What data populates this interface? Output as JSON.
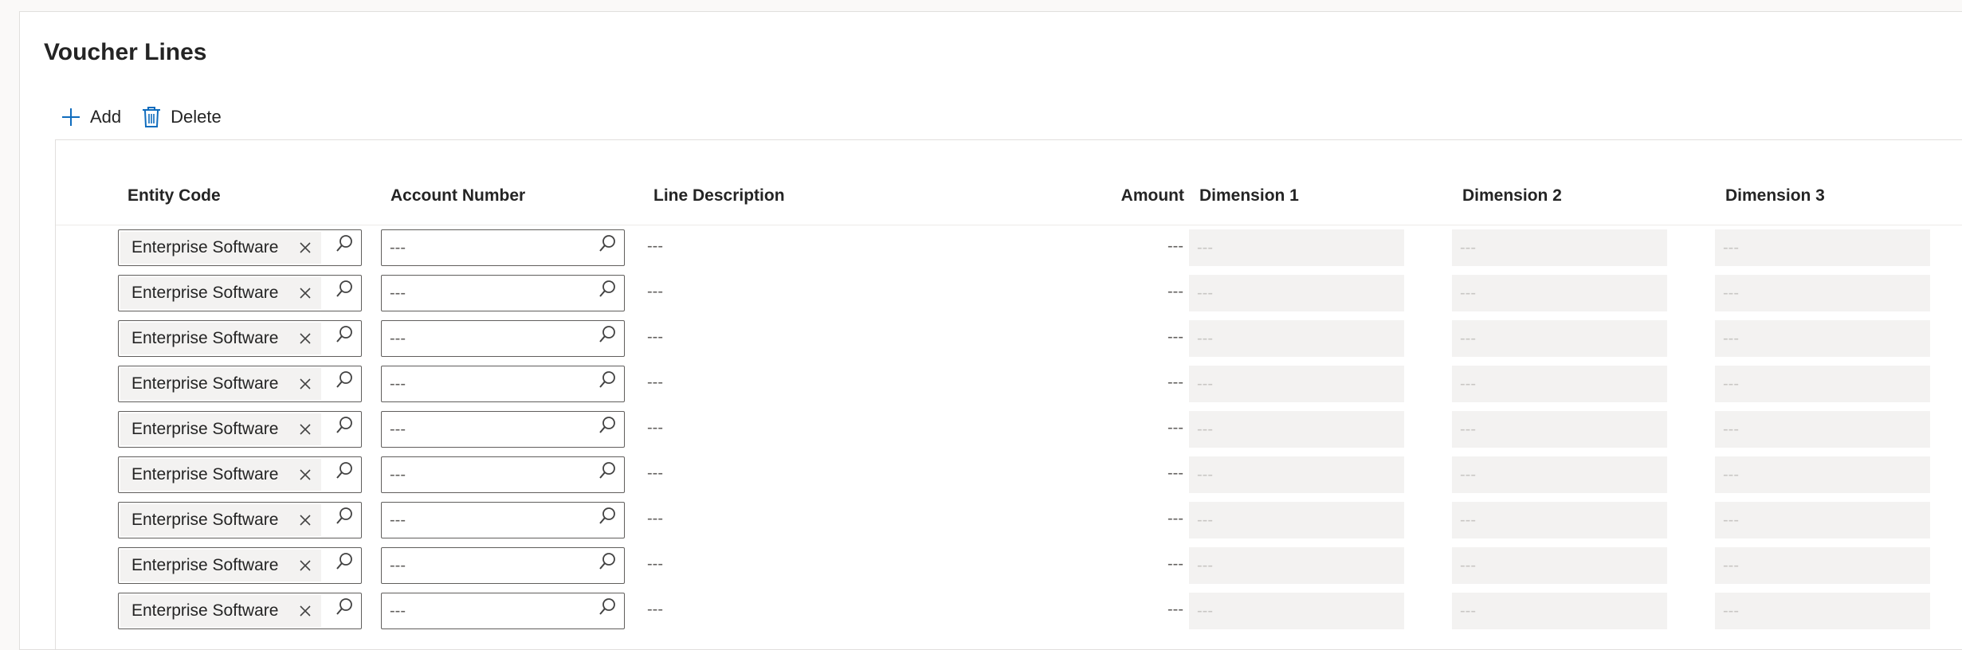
{
  "section": {
    "title": "Voucher Lines"
  },
  "toolbar": {
    "add_label": "Add",
    "delete_label": "Delete"
  },
  "columns": {
    "entity_code": "Entity Code",
    "account_number": "Account Number",
    "line_description": "Line Description",
    "amount": "Amount",
    "dimension_1": "Dimension 1",
    "dimension_2": "Dimension 2",
    "dimension_3": "Dimension 3"
  },
  "rows": [
    {
      "entity": "Enterprise Software",
      "account": "---",
      "description": "---",
      "amount": "---",
      "dim1": "---",
      "dim2": "---",
      "dim3": "---"
    },
    {
      "entity": "Enterprise Software",
      "account": "---",
      "description": "---",
      "amount": "---",
      "dim1": "---",
      "dim2": "---",
      "dim3": "---"
    },
    {
      "entity": "Enterprise Software",
      "account": "---",
      "description": "---",
      "amount": "---",
      "dim1": "---",
      "dim2": "---",
      "dim3": "---"
    },
    {
      "entity": "Enterprise Software",
      "account": "---",
      "description": "---",
      "amount": "---",
      "dim1": "---",
      "dim2": "---",
      "dim3": "---"
    },
    {
      "entity": "Enterprise Software",
      "account": "---",
      "description": "---",
      "amount": "---",
      "dim1": "---",
      "dim2": "---",
      "dim3": "---"
    },
    {
      "entity": "Enterprise Software",
      "account": "---",
      "description": "---",
      "amount": "---",
      "dim1": "---",
      "dim2": "---",
      "dim3": "---"
    },
    {
      "entity": "Enterprise Software",
      "account": "---",
      "description": "---",
      "amount": "---",
      "dim1": "---",
      "dim2": "---",
      "dim3": "---"
    },
    {
      "entity": "Enterprise Software",
      "account": "---",
      "description": "---",
      "amount": "---",
      "dim1": "---",
      "dim2": "---",
      "dim3": "---"
    },
    {
      "entity": "Enterprise Software",
      "account": "---",
      "description": "---",
      "amount": "---",
      "dim1": "---",
      "dim2": "---",
      "dim3": "---"
    }
  ],
  "icons": {
    "add": "plus-icon",
    "delete": "trash-icon",
    "remove_tag": "close-icon",
    "lookup": "search-icon"
  },
  "colors": {
    "accent": "#0f6cbd",
    "field_border": "#605e5c",
    "readonly_bg": "#f3f2f1"
  }
}
